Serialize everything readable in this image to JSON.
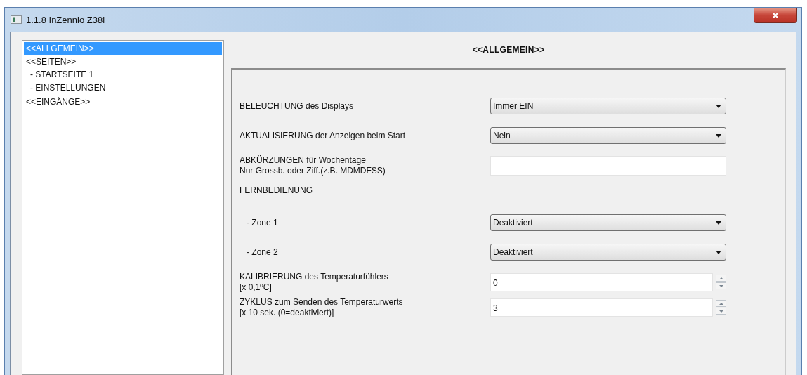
{
  "window": {
    "title": "1.1.8 InZennio Z38i"
  },
  "sidebar": {
    "items": [
      {
        "label": "<<ALLGEMEIN>>",
        "selected": true
      },
      {
        "label": "<<SEITEN>>",
        "selected": false,
        "children": [
          {
            "label": "- STARTSEITE 1",
            "selected": false
          },
          {
            "label": "- EINSTELLUNGEN",
            "selected": false
          }
        ]
      },
      {
        "label": "<<EINGÄNGE>>",
        "selected": false
      }
    ]
  },
  "panel": {
    "title": "<<ALLGEMEIN>>",
    "rows": [
      {
        "kind": "select",
        "label": [
          "BELEUCHTUNG des Displays"
        ],
        "value": "Immer EIN"
      },
      {
        "kind": "select",
        "label": [
          "AKTUALISIERUNG der Anzeigen beim Start"
        ],
        "value": "Nein"
      },
      {
        "kind": "text",
        "label": [
          "ABKÜRZUNGEN für Wochentage",
          "Nur Grossb. oder Ziff.(z.B. MDMDFSS)"
        ]
      },
      {
        "kind": "heading",
        "label": [
          "FERNBEDIENUNG"
        ]
      },
      {
        "kind": "select",
        "label": [
          "- Zone 1"
        ],
        "value": "Deaktiviert",
        "indent": true
      },
      {
        "kind": "select",
        "label": [
          "- Zone 2"
        ],
        "value": "Deaktiviert",
        "indent": true
      },
      {
        "kind": "spinner",
        "label": [
          "KALIBRIERUNG des Temperaturfühlers",
          "[x 0,1ºC]"
        ],
        "value": "0"
      },
      {
        "kind": "spinner",
        "label": [
          "ZYKLUS zum Senden des Temperaturwerts",
          "[x 10 sek. (0=deaktiviert)]"
        ],
        "value": "3"
      }
    ]
  }
}
